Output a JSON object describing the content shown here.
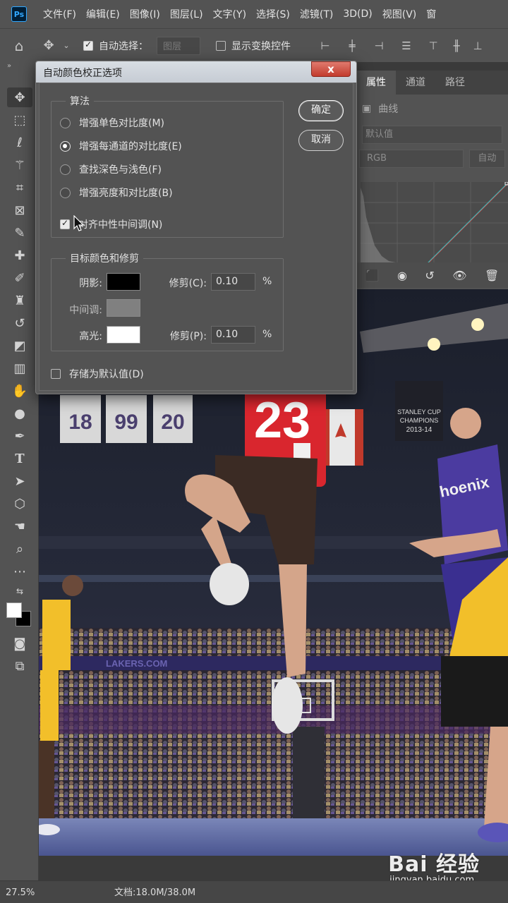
{
  "app": {
    "logo": "Ps"
  },
  "menu": [
    "文件(F)",
    "编辑(E)",
    "图像(I)",
    "图层(L)",
    "文字(Y)",
    "选择(S)",
    "滤镜(T)",
    "3D(D)",
    "视图(V)",
    "窗"
  ],
  "options_bar": {
    "auto_select_label": "自动选择：",
    "auto_select_checked": true,
    "auto_select_target": "图层",
    "show_transform_label": "显示变换控件",
    "show_transform_checked": false
  },
  "panel": {
    "tabs": [
      "属性",
      "通道",
      "路径"
    ],
    "active_tab": "属性",
    "adjustment": "曲线",
    "preset": "默认值",
    "channel": "RGB",
    "auto_label": "自动"
  },
  "dialog": {
    "title": "自动颜色校正选项",
    "close": "x",
    "algorithm_title": "算法",
    "algorithms": [
      {
        "label": "增强单色对比度(M)",
        "selected": false
      },
      {
        "label": "增强每通道的对比度(E)",
        "selected": true
      },
      {
        "label": "查找深色与浅色(F)",
        "selected": false
      },
      {
        "label": "增强亮度和对比度(B)",
        "selected": false
      }
    ],
    "snap_neutral_label": "对齐中性中间调(N)",
    "snap_neutral_checked": true,
    "targets_title": "目标颜色和修剪",
    "shadows_label": "阴影:",
    "shadows_color": "#000000",
    "shadows_clip_label": "修剪(C):",
    "shadows_clip_value": "0.10",
    "midtones_label": "中间调:",
    "midtones_color": "#808080",
    "highlights_label": "高光:",
    "highlights_color": "#ffffff",
    "highlights_clip_label": "修剪(P):",
    "highlights_clip_value": "0.10",
    "percent": "%",
    "save_default_label": "存储为默认值(D)",
    "save_default_checked": false,
    "ok_label": "确定",
    "cancel_label": "取消"
  },
  "image": {
    "banners": [
      "18",
      "99",
      "20"
    ],
    "jersey_number": "23",
    "suns_text": "hoenix",
    "lakers_text": "LAKERS.COM",
    "champions": [
      "STANLEY CUP",
      "CHAMPIONS",
      "2013-14"
    ]
  },
  "status": {
    "zoom": "27.5%",
    "doc": "文档:18.0M/38.0M"
  },
  "watermark": {
    "logo": "Bai 经验",
    "url": "jingyan.baidu.com"
  },
  "colors": {
    "accent": "#31a8ff",
    "panel": "#535353",
    "menubar": "#535353",
    "close": "#c94a3c"
  }
}
